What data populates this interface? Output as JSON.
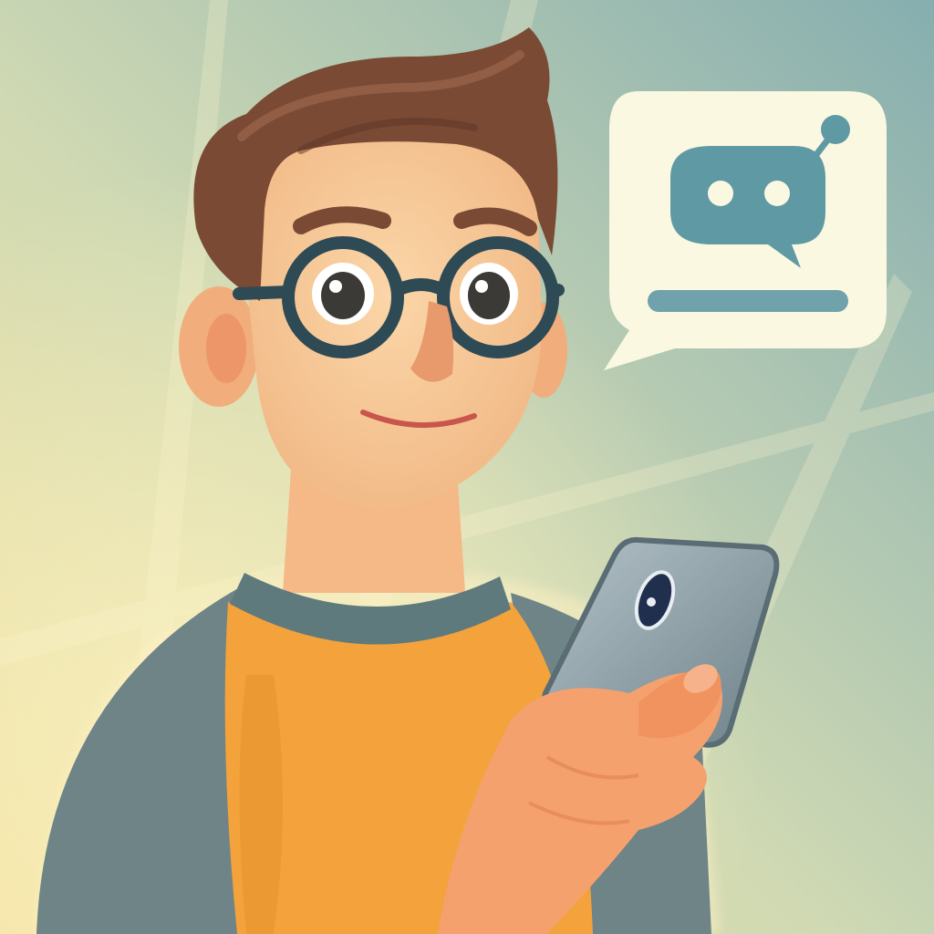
{
  "scene": {
    "kind": "illustration",
    "subject": "person-holding-phone",
    "accessory": "round-glasses",
    "speech_bubble": {
      "icon": "chatbot-icon",
      "has_text_line": true
    }
  },
  "palette": {
    "bg_warm": "#f2e2a2",
    "bg_cool": "#86aeb0",
    "skin": "#f6c493",
    "skin_shadow": "#e89a6c",
    "hair": "#7a4a35",
    "hair_dark": "#5a3325",
    "shirt_body": "#f3a23c",
    "shirt_sleeve": "#6f8487",
    "collar": "#5f7a7d",
    "glasses": "#2e4a55",
    "phone_body": "#8fa1a8",
    "phone_screen": "#6b7f87",
    "bubble_fill": "#fbf8e2",
    "bubble_icon": "#5f9aa4",
    "bubble_line": "#6fa2ab"
  }
}
